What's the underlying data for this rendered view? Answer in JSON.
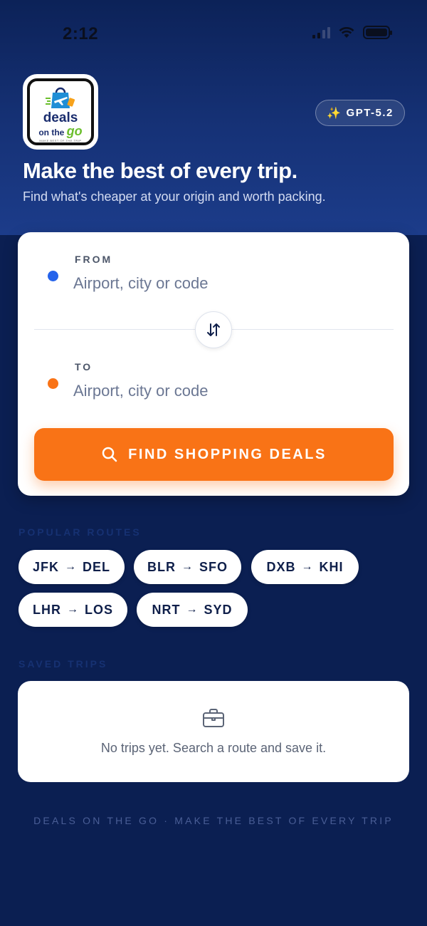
{
  "status_bar": {
    "time": "2:12"
  },
  "header": {
    "logo_text": {
      "word1": "deals",
      "word2a": "on the ",
      "word2b": "go",
      "tag": "MAKE BEST OF THE TRIP"
    },
    "model_badge": "GPT-5.2",
    "title": "Make the best of every trip.",
    "subtitle": "Find what's cheaper at your origin and worth packing."
  },
  "search": {
    "from_label": "FROM",
    "from_placeholder": "Airport, city or code",
    "to_label": "TO",
    "to_placeholder": "Airport, city or code",
    "find_button": "FIND SHOPPING DEALS"
  },
  "popular": {
    "heading": "POPULAR ROUTES",
    "routes": [
      {
        "from": "JFK",
        "to": "DEL"
      },
      {
        "from": "BLR",
        "to": "SFO"
      },
      {
        "from": "DXB",
        "to": "KHI"
      },
      {
        "from": "LHR",
        "to": "LOS"
      },
      {
        "from": "NRT",
        "to": "SYD"
      }
    ]
  },
  "saved": {
    "heading": "SAVED TRIPS",
    "empty_text": "No trips yet. Search a route and save it."
  },
  "footer": "DEALS ON THE GO · MAKE THE BEST OF EVERY TRIP",
  "colors": {
    "primary_blue": "#0b1f52",
    "accent_orange": "#f97316",
    "dot_blue": "#2563eb"
  }
}
